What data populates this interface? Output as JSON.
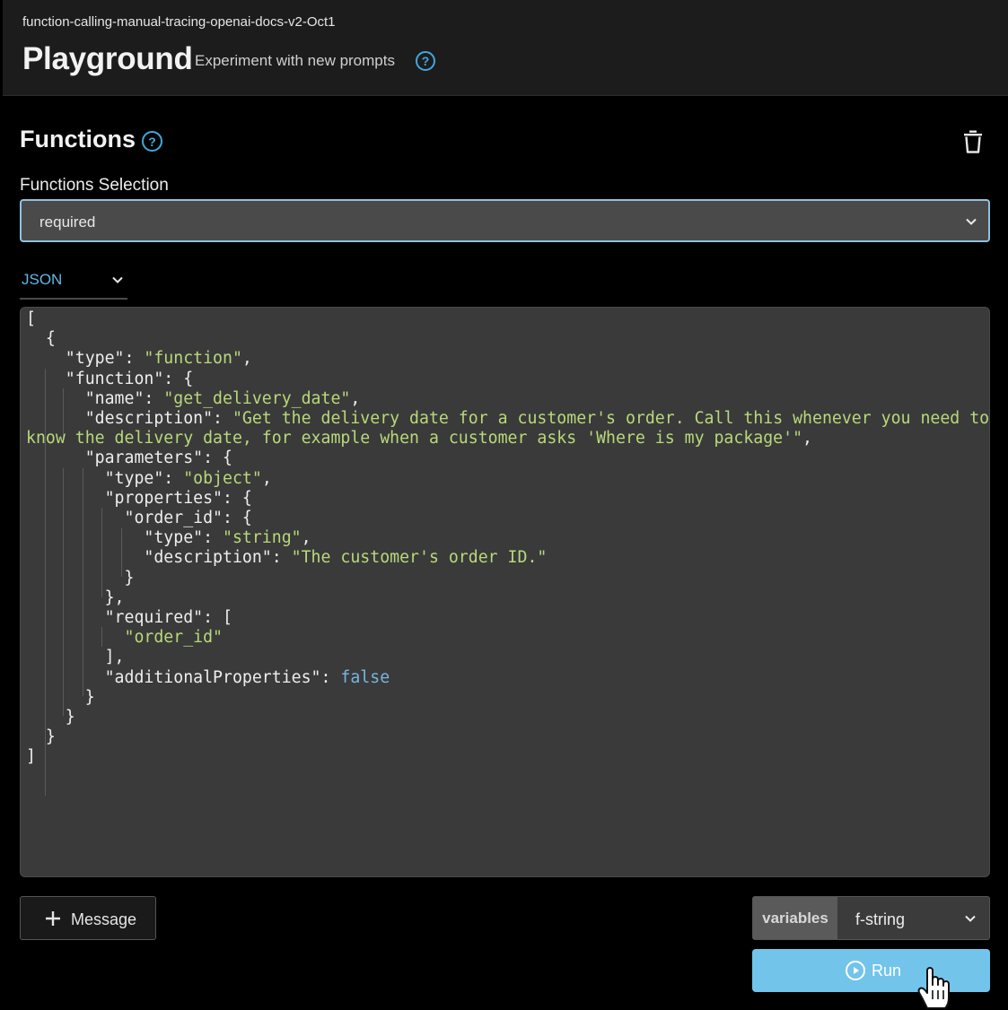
{
  "header": {
    "project_name": "function-calling-manual-tracing-openai-docs-v2-Oct1",
    "title": "Playground",
    "subtitle": "Experiment with new prompts",
    "help_icon": "question-circle-icon"
  },
  "functions": {
    "title": "Functions",
    "help_icon": "question-circle-icon",
    "delete_icon": "trash-icon",
    "selection_label": "Functions Selection",
    "selection_value": "required",
    "format_tab": "JSON",
    "code_lines": [
      "[",
      "  {",
      "    \"type\": \"function\",",
      "    \"function\": {",
      "      \"name\": \"get_delivery_date\",",
      "      \"description\": \"Get the delivery date for a customer's order. Call this whenever you need to",
      "know the delivery date, for example when a customer asks 'Where is my package'\",",
      "      \"parameters\": {",
      "        \"type\": \"object\",",
      "        \"properties\": {",
      "          \"order_id\": {",
      "            \"type\": \"string\",",
      "            \"description\": \"The customer's order ID.\"",
      "          }",
      "        },",
      "        \"required\": [",
      "          \"order_id\"",
      "        ],",
      "        \"additionalProperties\": false",
      "      }",
      "    }",
      "  }",
      "]"
    ]
  },
  "footer": {
    "message_button": "Message",
    "variables_label": "variables",
    "variables_value": "f-string",
    "run_button": "Run"
  },
  "colors": {
    "accent": "#43a7de",
    "run_button": "#72c4ea",
    "string": "#b8d97a",
    "keyword": "#78b6e0"
  }
}
